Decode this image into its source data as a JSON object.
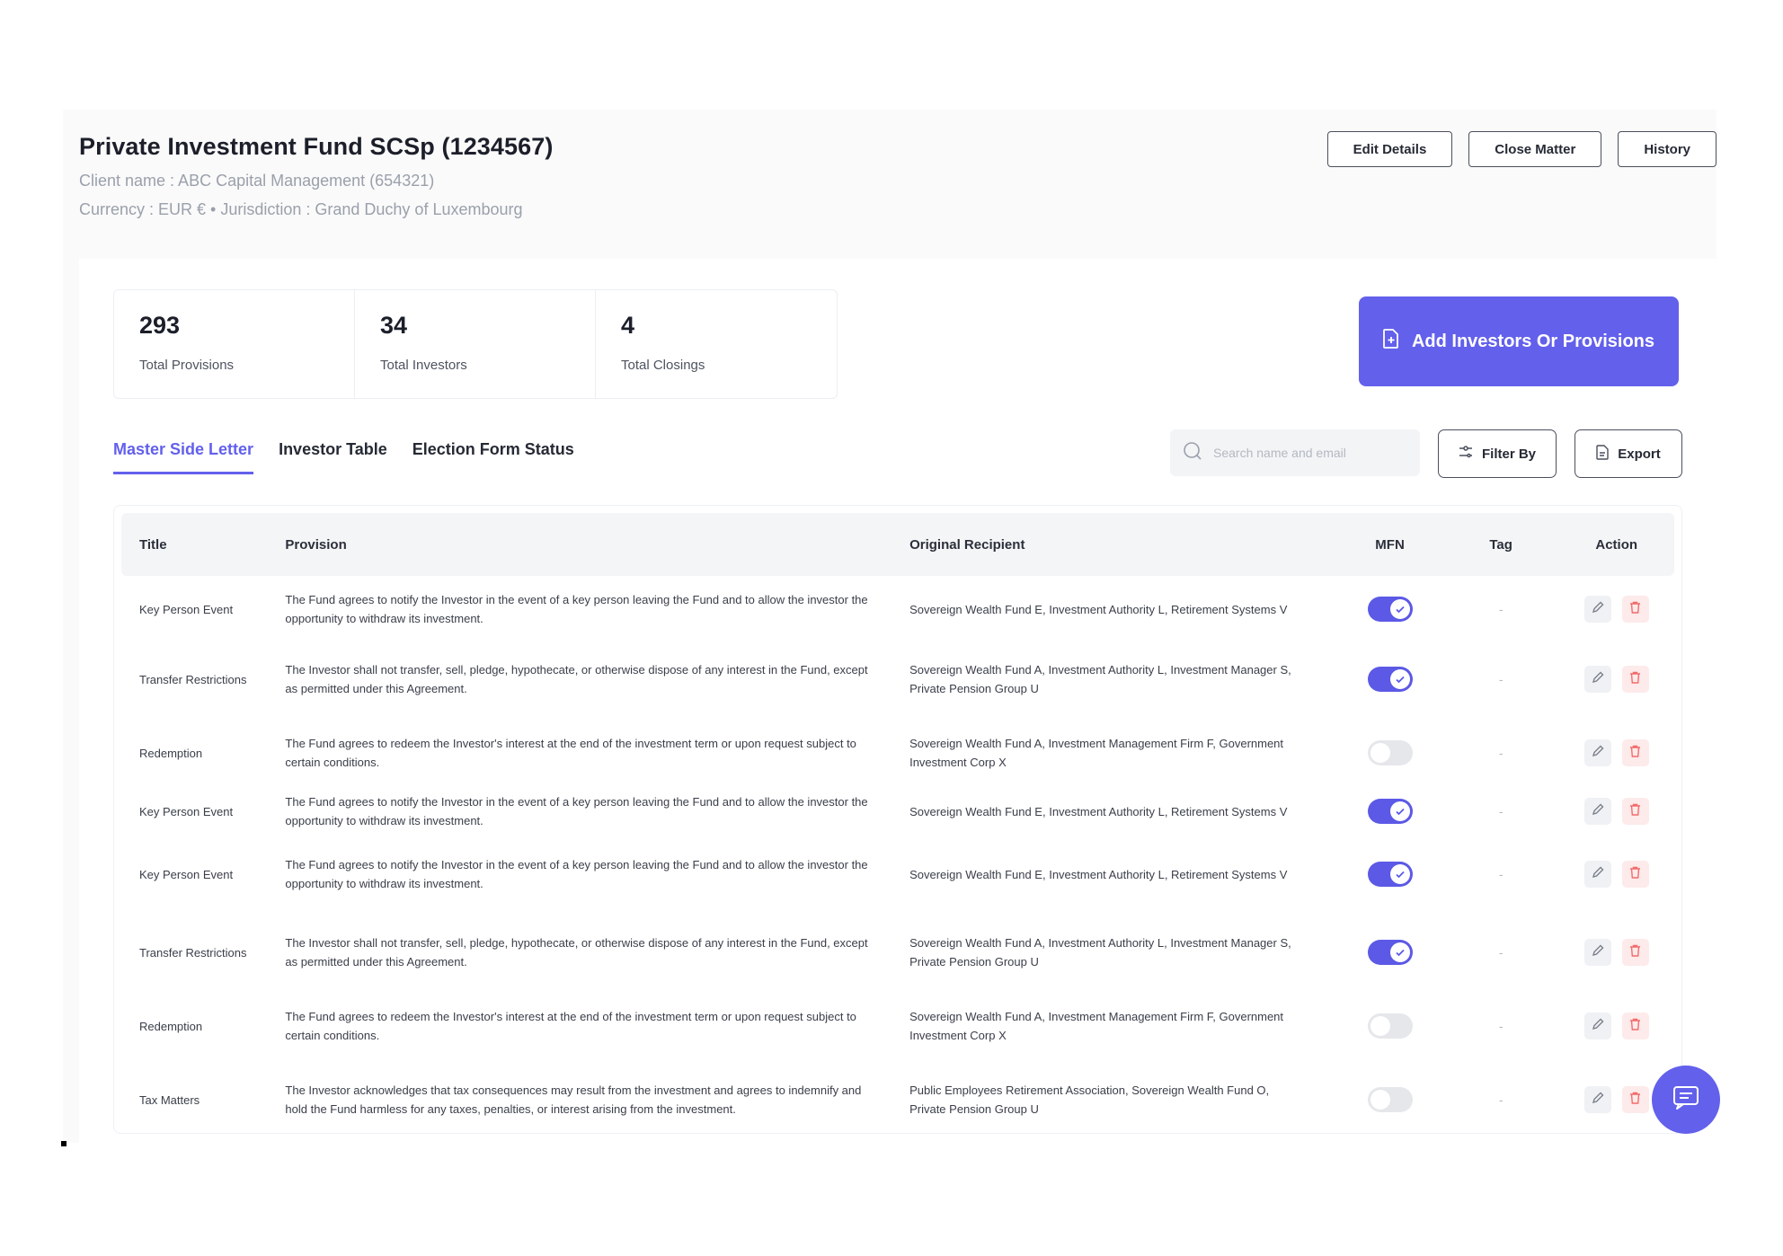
{
  "header": {
    "title": "Private Investment Fund SCSp (1234567)",
    "client_line": "Client name : ABC Capital Management (654321)",
    "currency_line": "Currency : EUR € • Jurisdiction : Grand Duchy of Luxembourg",
    "actions": [
      "Edit Details",
      "Close Matter",
      "History"
    ]
  },
  "stats": [
    {
      "value": "293",
      "label": "Total Provisions"
    },
    {
      "value": "34",
      "label": "Total Investors"
    },
    {
      "value": "4",
      "label": "Total Closings"
    }
  ],
  "primary_action": {
    "label": "Add Investors Or Provisions",
    "icon": "file-plus-icon"
  },
  "tabs": [
    {
      "label": "Master Side Letter",
      "active": true
    },
    {
      "label": "Investor Table",
      "active": false
    },
    {
      "label": "Election Form Status",
      "active": false
    }
  ],
  "search": {
    "placeholder": "Search name and email",
    "value": ""
  },
  "toolbar": {
    "filter_label": "Filter By",
    "export_label": "Export"
  },
  "table": {
    "columns": [
      "Title",
      "Provision",
      "Original Recipient",
      "MFN",
      "Tag",
      "Action"
    ],
    "rows": [
      {
        "title": "Key Person Event",
        "provision": "The Fund agrees to notify the Investor in the event of a key person leaving the Fund and to allow the investor the opportunity to withdraw its investment.",
        "recipient": "Sovereign Wealth Fund E, Investment Authority L, Retirement Systems V",
        "mfn": true,
        "tag": "-"
      },
      {
        "title": "Transfer Restrictions",
        "provision": "The Investor shall not transfer, sell, pledge, hypothecate, or otherwise dispose of any interest in the Fund, except as permitted under this Agreement.",
        "recipient": "Sovereign Wealth Fund A, Investment Authority L, Investment Manager S, Private Pension Group U",
        "mfn": true,
        "tag": "-"
      },
      {
        "title": "Redemption",
        "provision": "The Fund agrees to redeem the Investor's interest at the end of the investment term or upon request subject to certain conditions.",
        "recipient": "Sovereign Wealth Fund A, Investment Management Firm F, Government Investment Corp X",
        "mfn": false,
        "tag": "-"
      },
      {
        "title": "Key Person Event",
        "provision": "The Fund agrees to notify the Investor in the event of a key person leaving the Fund and to allow the investor the opportunity to withdraw its investment.",
        "recipient": "Sovereign Wealth Fund E, Investment Authority L, Retirement Systems V",
        "mfn": true,
        "tag": "-"
      },
      {
        "title": "Key Person Event",
        "provision": "The Fund agrees to notify the Investor in the event of a key person leaving the Fund and to allow the investor the opportunity to withdraw its investment.",
        "recipient": "Sovereign Wealth Fund E, Investment Authority L, Retirement Systems V",
        "mfn": true,
        "tag": "-"
      },
      {
        "title": "Transfer Restrictions",
        "provision": "The Investor shall not transfer, sell, pledge, hypothecate, or otherwise dispose of any interest in the Fund, except as permitted under this Agreement.",
        "recipient": "Sovereign Wealth Fund A, Investment Authority L, Investment Manager S, Private Pension Group U",
        "mfn": true,
        "tag": "-"
      },
      {
        "title": "Redemption",
        "provision": "The Fund agrees to redeem the Investor's interest at the end of the investment term or upon request subject to certain conditions.",
        "recipient": "Sovereign Wealth Fund A, Investment Management Firm F, Government Investment Corp X",
        "mfn": false,
        "tag": "-"
      },
      {
        "title": "Tax Matters",
        "provision": "The Investor acknowledges that tax consequences may result from the investment and agrees to indemnify and hold the Fund harmless for any taxes, penalties, or interest arising from the investment.",
        "recipient": "Public Employees Retirement Association, Sovereign Wealth Fund O, Private Pension Group U",
        "mfn": false,
        "tag": "-"
      }
    ]
  },
  "colors": {
    "accent": "#6360ec",
    "toggle_on": "#5c59e6",
    "delete": "#f26b6b"
  },
  "chat": {
    "icon": "chat-icon"
  }
}
